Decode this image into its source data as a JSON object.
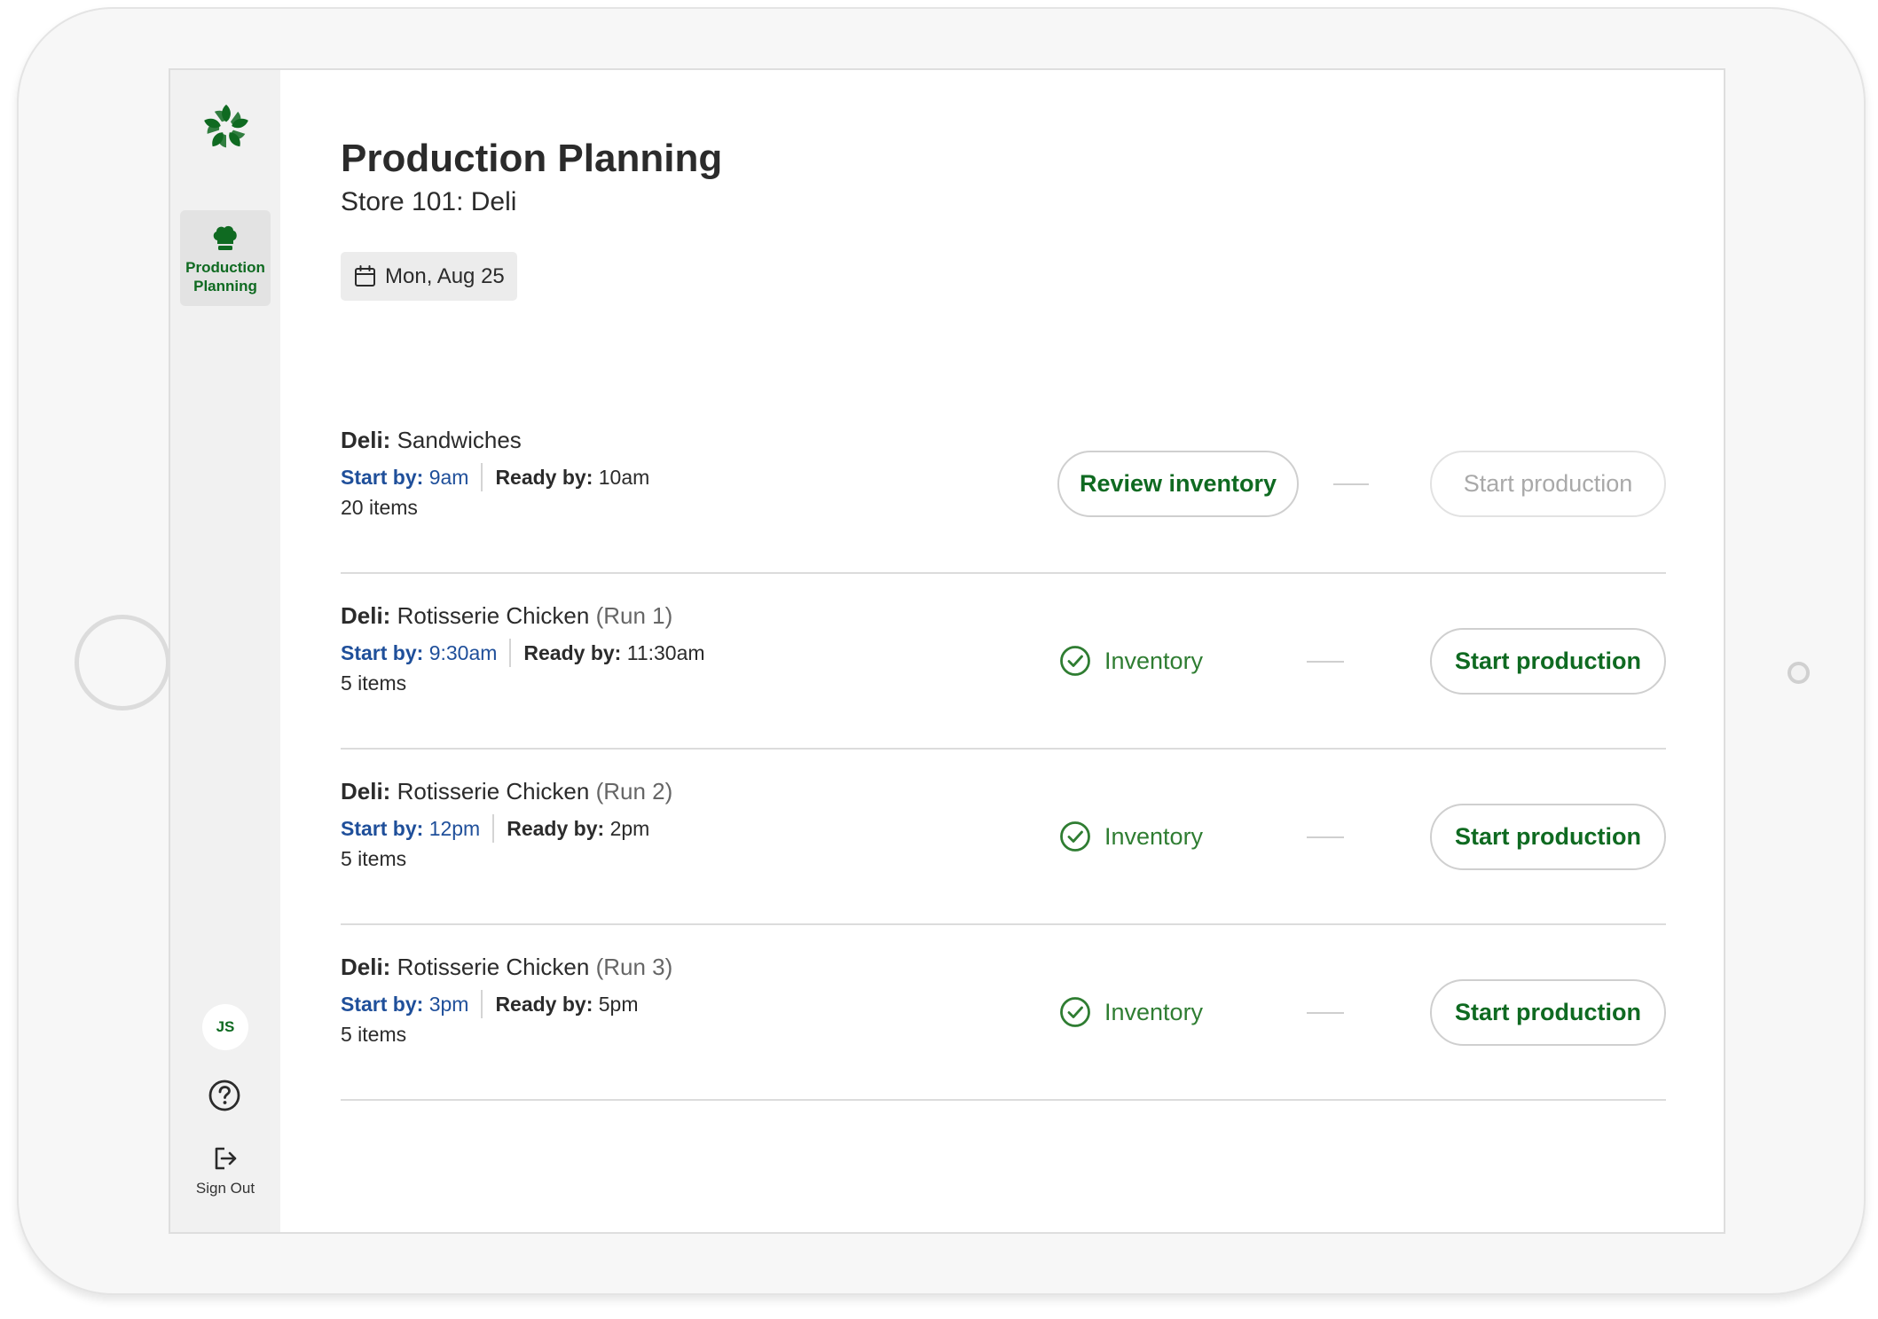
{
  "app": {
    "nav": [
      {
        "label": "Production Planning",
        "icon": "chef-hat-icon",
        "active": true
      }
    ],
    "user_initials": "JS",
    "help_icon": "question-circle-icon",
    "signout_label": "Sign Out",
    "accent_color": "#0f6a21"
  },
  "page": {
    "title": "Production Planning",
    "subtitle": "Store 101: Deli",
    "date": "Mon, Aug 25"
  },
  "runs": [
    {
      "dept": "Deli:",
      "name": "Sandwiches",
      "run": "",
      "start_label": "Start by:",
      "start_time": "9am",
      "ready_label": "Ready by:",
      "ready_time": "10am",
      "items": "20 items",
      "inventory_action": "Review inventory",
      "production_action": "Start production",
      "production_enabled": false
    },
    {
      "dept": "Deli:",
      "name": "Rotisserie Chicken",
      "run": "(Run 1)",
      "start_label": "Start by:",
      "start_time": "9:30am",
      "ready_label": "Ready by:",
      "ready_time": "11:30am",
      "items": "5 items",
      "inventory_status": "Inventory",
      "production_action": "Start production",
      "production_enabled": true
    },
    {
      "dept": "Deli:",
      "name": "Rotisserie Chicken",
      "run": "(Run 2)",
      "start_label": "Start by:",
      "start_time": "12pm",
      "ready_label": "Ready by:",
      "ready_time": "2pm",
      "items": "5 items",
      "inventory_status": "Inventory",
      "production_action": "Start production",
      "production_enabled": true
    },
    {
      "dept": "Deli:",
      "name": "Rotisserie Chicken",
      "run": "(Run 3)",
      "start_label": "Start by:",
      "start_time": "3pm",
      "ready_label": "Ready by:",
      "ready_time": "5pm",
      "items": "5 items",
      "inventory_status": "Inventory",
      "production_action": "Start production",
      "production_enabled": true
    }
  ]
}
